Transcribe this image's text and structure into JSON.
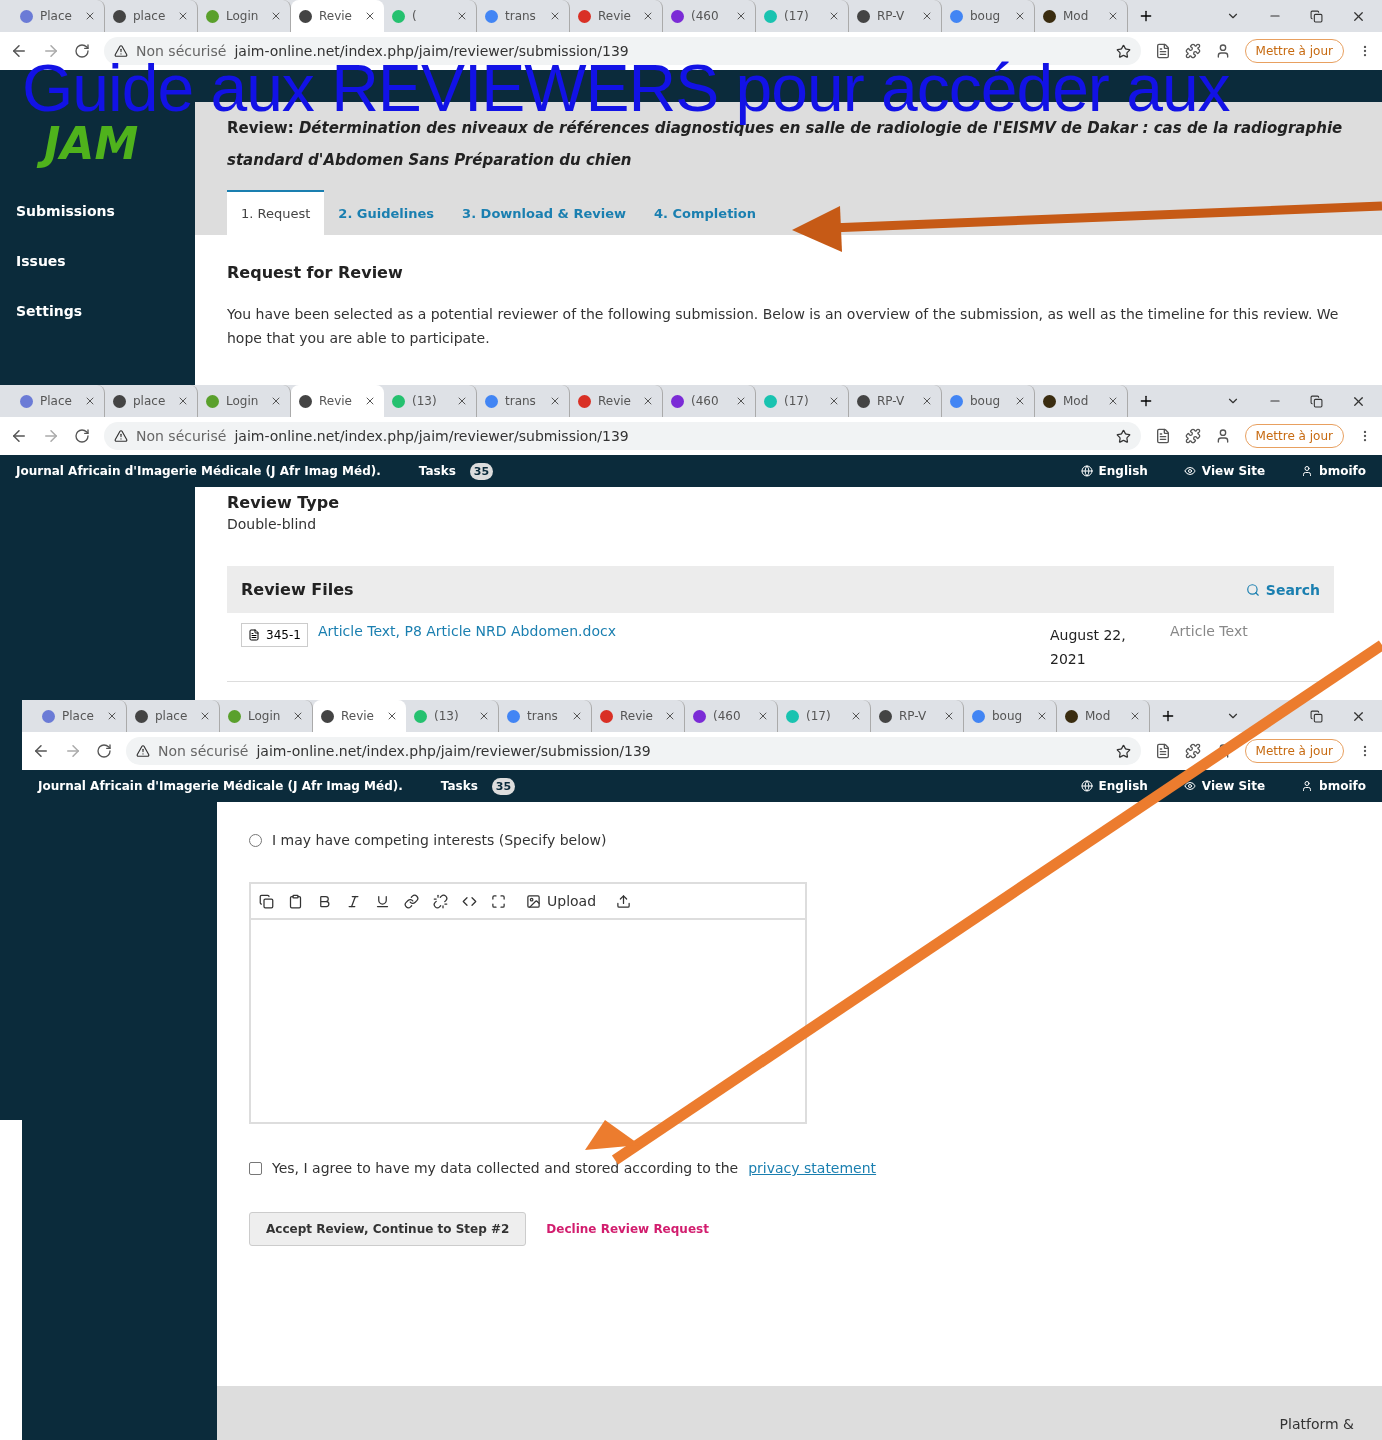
{
  "overlay_title": "Guide aux REVIEWERS pour accéder aux",
  "screens": [
    {
      "kind": "request",
      "browser": {
        "tabs": [
          {
            "label": "Place",
            "color": "#6b7bd6",
            "selected": false
          },
          {
            "label": "place",
            "color": "#444444",
            "selected": false
          },
          {
            "label": "Login",
            "color": "#5aa02c",
            "selected": false
          },
          {
            "label": "Revie",
            "color": "#444444",
            "selected": true
          },
          {
            "label": "(",
            "color": "#25c16f",
            "selected": false
          },
          {
            "label": "trans",
            "color": "#4285f4",
            "selected": false
          },
          {
            "label": "Revie",
            "color": "#d93025",
            "selected": false
          },
          {
            "label": "(460",
            "color": "#7b2bd6",
            "selected": false
          },
          {
            "label": "(17)",
            "color": "#19c3b0",
            "selected": false
          },
          {
            "label": "RP-V",
            "color": "#444444",
            "selected": false
          },
          {
            "label": "boug",
            "color": "#4285f4",
            "selected": false
          },
          {
            "label": "Mod",
            "color": "#3a2c10",
            "selected": false
          }
        ],
        "security": "Non sécurisé",
        "url": "jaim-online.net/index.php/jaim/reviewer/submission/139",
        "update_button": "Mettre à jour"
      },
      "sidebar": {
        "logo": "JAM",
        "items": [
          "Submissions",
          "Issues",
          "Settings"
        ]
      },
      "review_title": "Review: *Détermination des niveaux de références diagnostiques en salle de radiologie de l'EISMV de Dakar : cas de la radiographie standard d'Abdomen Sans Préparation du chien*",
      "steps": [
        {
          "label": "1. Request",
          "selected": true
        },
        {
          "label": "2. Guidelines",
          "selected": false
        },
        {
          "label": "3. Download & Review",
          "selected": false
        },
        {
          "label": "4. Completion",
          "selected": false
        }
      ],
      "heading": "Request for Review",
      "paragraph": "You have been selected as a potential reviewer of the following submission. Below is an overview of the submission, as well as the timeline for this review. We hope that you are able to participate."
    },
    {
      "kind": "files",
      "browser": {
        "tabs": [
          {
            "label": "Place",
            "color": "#6b7bd6",
            "selected": false
          },
          {
            "label": "place",
            "color": "#444444",
            "selected": false
          },
          {
            "label": "Login",
            "color": "#5aa02c",
            "selected": false
          },
          {
            "label": "Revie",
            "color": "#444444",
            "selected": true
          },
          {
            "label": "(13)",
            "color": "#25c16f",
            "selected": false
          },
          {
            "label": "trans",
            "color": "#4285f4",
            "selected": false
          },
          {
            "label": "Revie",
            "color": "#d93025",
            "selected": false
          },
          {
            "label": "(460",
            "color": "#7b2bd6",
            "selected": false
          },
          {
            "label": "(17)",
            "color": "#19c3b0",
            "selected": false
          },
          {
            "label": "RP-V",
            "color": "#444444",
            "selected": false
          },
          {
            "label": "boug",
            "color": "#4285f4",
            "selected": false
          },
          {
            "label": "Mod",
            "color": "#3a2c10",
            "selected": false
          }
        ],
        "security": "Non sécurisé",
        "url": "jaim-online.net/index.php/jaim/reviewer/submission/139",
        "update_button": "Mettre à jour"
      },
      "header": {
        "journal": "Journal Africain d'Imagerie Médicale (J Afr Imag Méd).",
        "tasks": "Tasks",
        "task_count": "35",
        "language": "English",
        "view_site": "View Site",
        "user": "bmoifo"
      },
      "review_type_label": "Review Type",
      "review_type": "Double-blind",
      "files_title": "Review Files",
      "search": "Search",
      "files": [
        {
          "id": "345-1",
          "name": "Article Text, P8 Article NRD Abdomen.docx",
          "date": "August 22, 2021",
          "type": "Article Text"
        }
      ]
    },
    {
      "kind": "form",
      "browser": {
        "tabs": [
          {
            "label": "Place",
            "color": "#6b7bd6",
            "selected": false
          },
          {
            "label": "place",
            "color": "#444444",
            "selected": false
          },
          {
            "label": "Login",
            "color": "#5aa02c",
            "selected": false
          },
          {
            "label": "Revie",
            "color": "#444444",
            "selected": true
          },
          {
            "label": "(13)",
            "color": "#25c16f",
            "selected": false
          },
          {
            "label": "trans",
            "color": "#4285f4",
            "selected": false
          },
          {
            "label": "Revie",
            "color": "#d93025",
            "selected": false
          },
          {
            "label": "(460",
            "color": "#7b2bd6",
            "selected": false
          },
          {
            "label": "(17)",
            "color": "#19c3b0",
            "selected": false
          },
          {
            "label": "RP-V",
            "color": "#444444",
            "selected": false
          },
          {
            "label": "boug",
            "color": "#4285f4",
            "selected": false
          },
          {
            "label": "Mod",
            "color": "#3a2c10",
            "selected": false
          }
        ],
        "security": "Non sécurisé",
        "url": "jaim-online.net/index.php/jaim/reviewer/submission/139",
        "update_button": "Mettre à jour"
      },
      "header": {
        "journal": "Journal Africain d'Imagerie Médicale (J Afr Imag Méd).",
        "tasks": "Tasks",
        "task_count": "35",
        "language": "English",
        "view_site": "View Site",
        "user": "bmoifo"
      },
      "competing": {
        "label": "I may have competing interests (Specify below)",
        "selected": false
      },
      "upload": "Upload",
      "consent": {
        "text": "Yes, I agree to have my data collected and stored according to the",
        "link": "privacy statement",
        "checked": false
      },
      "accept_button": "Accept Review, Continue to Step #2",
      "decline_link": "Decline Review Request",
      "footer": "Platform &"
    }
  ]
}
